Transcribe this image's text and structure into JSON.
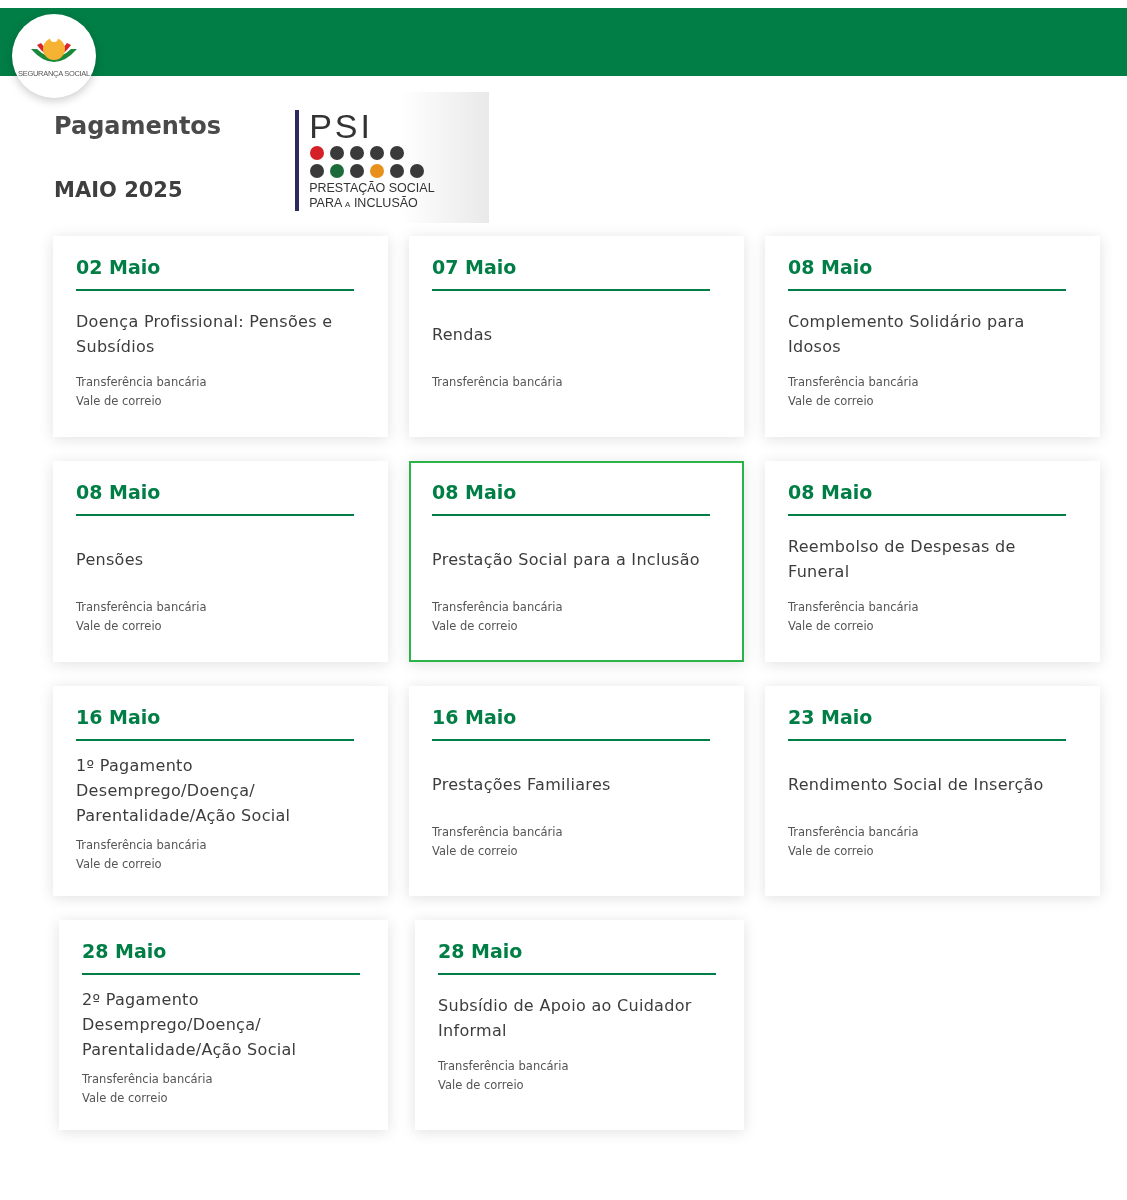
{
  "logo": {
    "caption": "SEGURANÇA SOCIAL"
  },
  "header": {
    "title": "Pagamentos",
    "month": "MAIO 2025"
  },
  "psi_logo": {
    "acronym": "PSI",
    "line_1": "PRESTAÇÃO SOCIAL",
    "line_2_start": "PARA",
    "line_2_small": "A",
    "line_2_end": "INCLUSÃO"
  },
  "cards": [
    {
      "date": "02 Maio",
      "title": "Doença Profissional: Pensões e Subsídios",
      "methods": [
        "Transferência bancária",
        "Vale de correio"
      ],
      "selected": false
    },
    {
      "date": "07 Maio",
      "title": "Rendas",
      "methods": [
        "Transferência bancária"
      ],
      "selected": false
    },
    {
      "date": "08 Maio",
      "title": "Complemento Solidário para Idosos",
      "methods": [
        "Transferência bancária",
        "Vale de correio"
      ],
      "selected": false
    },
    {
      "date": "08 Maio",
      "title": "Pensões",
      "methods": [
        "Transferência bancária",
        "Vale de correio"
      ],
      "selected": false
    },
    {
      "date": "08 Maio",
      "title": "Prestação Social para a Inclusão",
      "methods": [
        "Transferência bancária",
        "Vale de correio"
      ],
      "selected": true
    },
    {
      "date": "08 Maio",
      "title": "Reembolso de Despesas de Funeral",
      "methods": [
        "Transferência bancária",
        "Vale de correio"
      ],
      "selected": false
    },
    {
      "date": "16 Maio",
      "title": "1º Pagamento Desemprego/Doença/ Parentalidade/Ação Social",
      "methods": [
        "Transferência bancária",
        "Vale de correio"
      ],
      "selected": false
    },
    {
      "date": "16 Maio",
      "title": "Prestações Familiares",
      "methods": [
        "Transferência bancária",
        "Vale de correio"
      ],
      "selected": false
    },
    {
      "date": "23 Maio",
      "title": "Rendimento Social de Inserção",
      "methods": [
        "Transferência bancária",
        "Vale de correio"
      ],
      "selected": false
    },
    {
      "date": "28 Maio",
      "title": "2º Pagamento Desemprego/Doença/ Parentalidade/Ação Social",
      "methods": [
        "Transferência bancária",
        "Vale de correio"
      ],
      "selected": false
    },
    {
      "date": "28 Maio",
      "title": "Subsídio de Apoio ao Cuidador Informal",
      "methods": [
        "Transferência bancária",
        "Vale de correio"
      ],
      "selected": false
    }
  ]
}
